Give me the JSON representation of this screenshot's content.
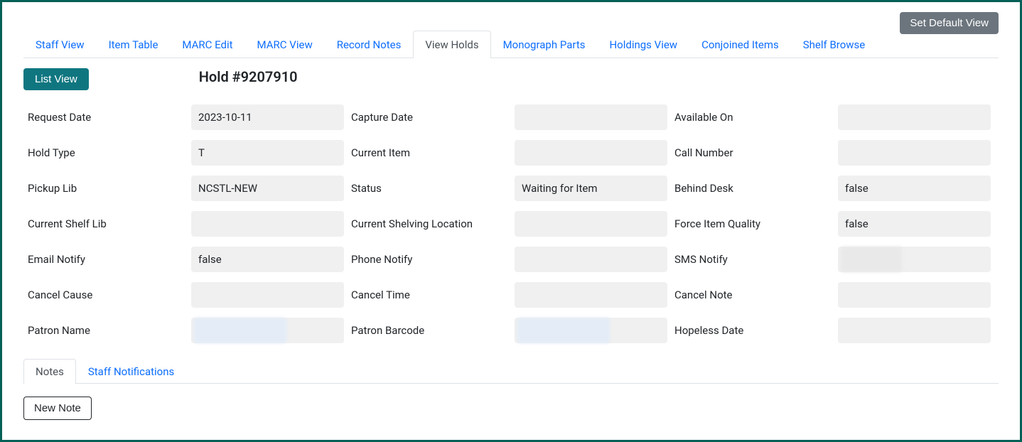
{
  "header": {
    "set_default_view": "Set Default View"
  },
  "tabs": [
    {
      "label": "Staff View",
      "active": false
    },
    {
      "label": "Item Table",
      "active": false
    },
    {
      "label": "MARC Edit",
      "active": false
    },
    {
      "label": "MARC View",
      "active": false
    },
    {
      "label": "Record Notes",
      "active": false
    },
    {
      "label": "View Holds",
      "active": true
    },
    {
      "label": "Monograph Parts",
      "active": false
    },
    {
      "label": "Holdings View",
      "active": false
    },
    {
      "label": "Conjoined Items",
      "active": false
    },
    {
      "label": "Shelf Browse",
      "active": false
    }
  ],
  "actions": {
    "list_view": "List View",
    "new_note": "New Note"
  },
  "hold": {
    "title": "Hold #9207910",
    "rows": [
      [
        {
          "label": "Request Date",
          "value": "2023-10-11"
        },
        {
          "label": "Capture Date",
          "value": ""
        },
        {
          "label": "Available On",
          "value": ""
        }
      ],
      [
        {
          "label": "Hold Type",
          "value": "T"
        },
        {
          "label": "Current Item",
          "value": ""
        },
        {
          "label": "Call Number",
          "value": ""
        }
      ],
      [
        {
          "label": "Pickup Lib",
          "value": "NCSTL-NEW"
        },
        {
          "label": "Status",
          "value": "Waiting for Item"
        },
        {
          "label": "Behind Desk",
          "value": "false"
        }
      ],
      [
        {
          "label": "Current Shelf Lib",
          "value": ""
        },
        {
          "label": "Current Shelving Location",
          "value": ""
        },
        {
          "label": "Force Item Quality",
          "value": "false"
        }
      ],
      [
        {
          "label": "Email Notify",
          "value": "false"
        },
        {
          "label": "Phone Notify",
          "value": ""
        },
        {
          "label": "SMS Notify",
          "value": "",
          "blurred": "gray"
        }
      ],
      [
        {
          "label": "Cancel Cause",
          "value": ""
        },
        {
          "label": "Cancel Time",
          "value": ""
        },
        {
          "label": "Cancel Note",
          "value": ""
        }
      ],
      [
        {
          "label": "Patron Name",
          "value": "",
          "blurred": "blue"
        },
        {
          "label": "Patron Barcode",
          "value": "",
          "blurred": "blue"
        },
        {
          "label": "Hopeless Date",
          "value": ""
        }
      ]
    ]
  },
  "sub_tabs": [
    {
      "label": "Notes",
      "active": true
    },
    {
      "label": "Staff Notifications",
      "active": false
    }
  ]
}
